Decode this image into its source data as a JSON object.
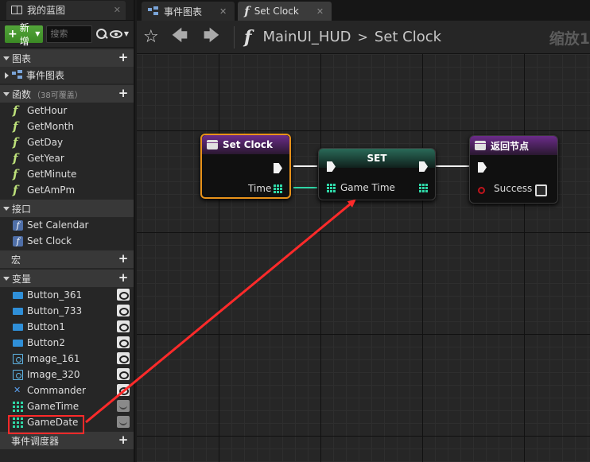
{
  "left_panel": {
    "tab_label": "我的蓝图",
    "add_label": "新增",
    "search_placeholder": "搜索",
    "sections": {
      "graphs": "图表",
      "event_graph": "事件图表",
      "functions": "函数",
      "functions_sub": "（38可覆盖）",
      "interfaces": "接口",
      "macros": "宏",
      "variables": "变量",
      "dispatchers": "事件调度器"
    },
    "functions": [
      "GetHour",
      "GetMonth",
      "GetDay",
      "GetYear",
      "GetMinute",
      "GetAmPm"
    ],
    "interfaces": [
      "Set Calendar",
      "Set Clock"
    ],
    "variables": [
      {
        "name": "Button_361",
        "icon": "button-icon",
        "visible": true
      },
      {
        "name": "Button_733",
        "icon": "button-icon",
        "visible": true
      },
      {
        "name": "Button1",
        "icon": "button-icon",
        "visible": true
      },
      {
        "name": "Button2",
        "icon": "button-icon",
        "visible": true
      },
      {
        "name": "Image_161",
        "icon": "image-icon",
        "visible": true
      },
      {
        "name": "Image_320",
        "icon": "image-icon",
        "visible": true
      },
      {
        "name": "Commander",
        "icon": "commander-icon",
        "visible": true
      },
      {
        "name": "GameTime",
        "icon": "struct-grid-icon",
        "visible": false
      },
      {
        "name": "GameDate",
        "icon": "struct-grid-icon",
        "visible": false
      }
    ]
  },
  "tabs": [
    {
      "label": "事件图表",
      "icon": "event-graph-icon",
      "active": false
    },
    {
      "label": "Set Clock",
      "icon": "function-icon",
      "active": true
    }
  ],
  "breadcrumb": {
    "blueprint": "MainUI_HUD",
    "separator": ">",
    "function": "Set Clock"
  },
  "zoom_label": "缩放1",
  "nodes": {
    "set_clock": {
      "title": "Set Clock",
      "pin_time": "Time"
    },
    "set": {
      "title": "SET",
      "pin_game_time": "Game Time"
    },
    "return": {
      "title": "返回节点",
      "pin_success": "Success"
    }
  },
  "colors": {
    "accent_green": "#3b8a25",
    "struct_pin": "#2fd6a6",
    "node_purple": "#6b2c8a",
    "highlight_red": "#ff2a2a",
    "selection_orange": "#e8921a"
  }
}
